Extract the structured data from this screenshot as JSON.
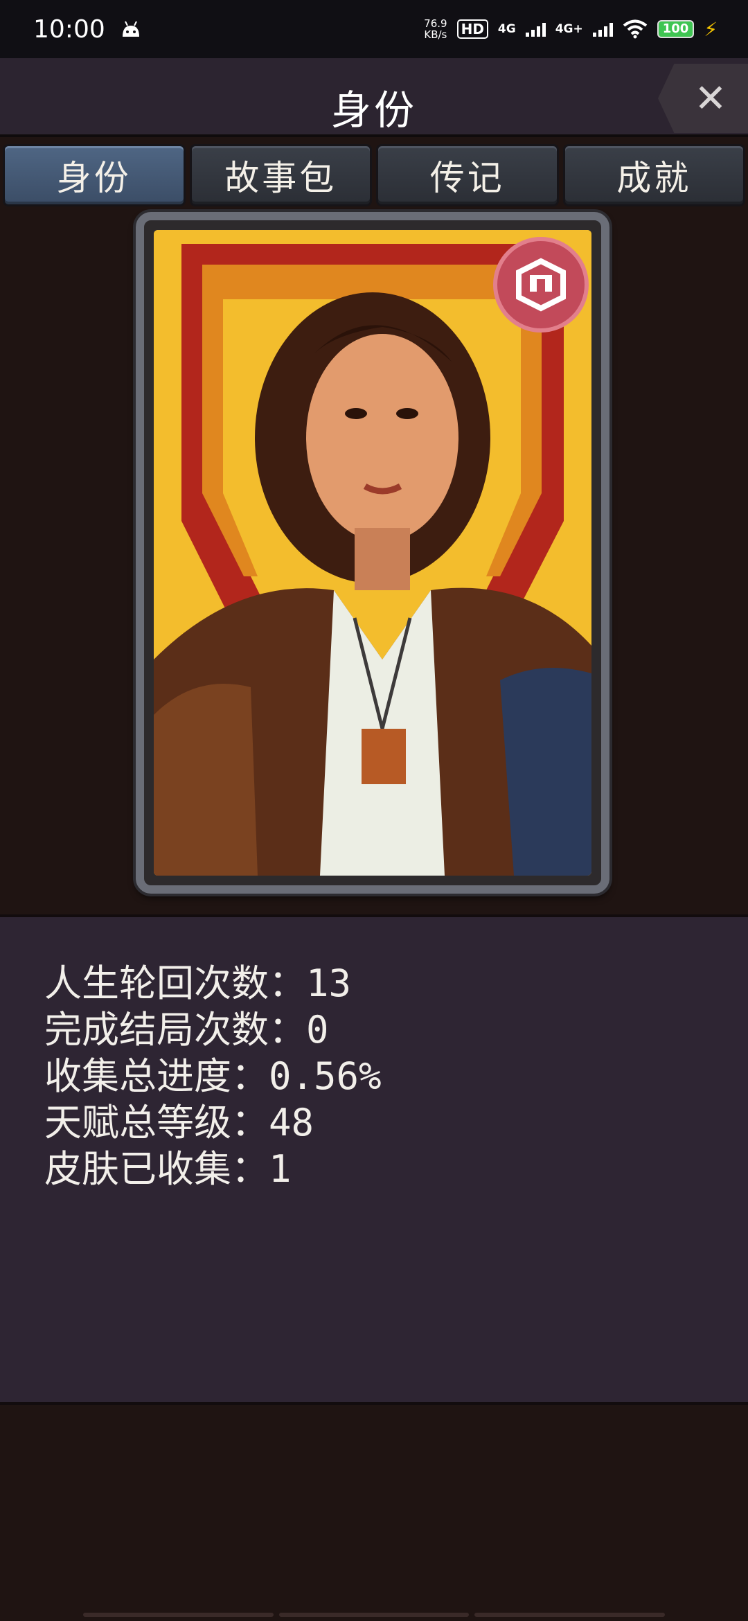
{
  "status_bar": {
    "time": "10:00",
    "net_speed_value": "76.9",
    "net_speed_unit": "KB/s",
    "hd_badge": "HD",
    "net_type_1": "4G",
    "net_type_2": "4G+",
    "battery": "100",
    "icons": [
      "android-icon",
      "signal-icon",
      "wifi-icon",
      "battery-icon",
      "charging-icon"
    ]
  },
  "header": {
    "title": "身份",
    "close_label": "✕"
  },
  "tabs": [
    {
      "label": "身份",
      "active": true
    },
    {
      "label": "故事包",
      "active": false
    },
    {
      "label": "传记",
      "active": false
    },
    {
      "label": "成就",
      "active": false
    }
  ],
  "card": {
    "portrait_icon": "portrait-illustration",
    "badge_icon": "emblem-icon",
    "colors": {
      "frame": "#6a6d77",
      "background": "#f2b92a",
      "badge": "#c24a5a"
    }
  },
  "stats": [
    "人生轮回次数：13",
    "完成结局次数：0",
    "收集总进度：0.56%",
    "天赋总等级：48",
    "皮肤已收集：1"
  ]
}
